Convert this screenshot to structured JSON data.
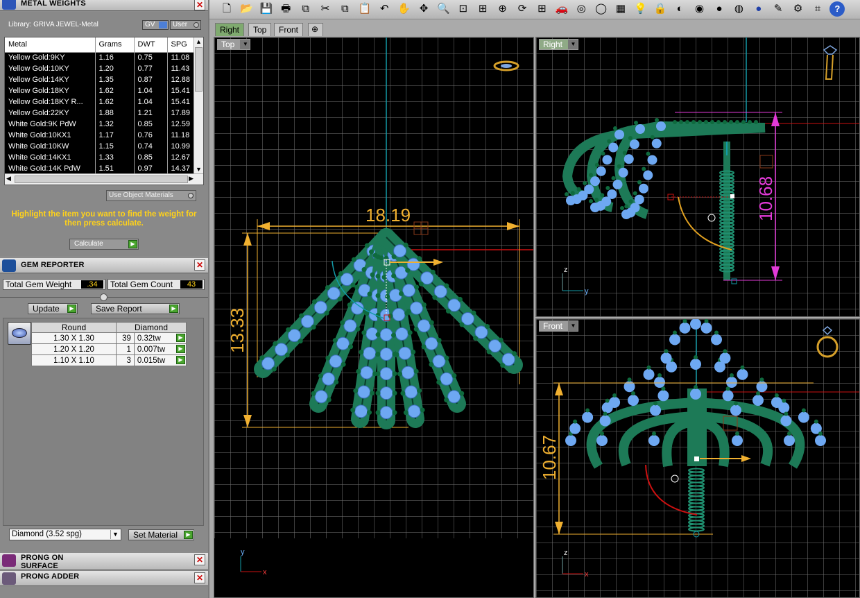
{
  "metal_weights": {
    "title": "METAL WEIGHTS",
    "library_label": "Library: GRIVA JEWEL-Metal",
    "toggle_gv": "GV",
    "toggle_user": "User",
    "columns": [
      "Metal",
      "Grams",
      "DWT",
      "SPG"
    ],
    "rows": [
      [
        "Yellow Gold:9KY",
        "1.16",
        "0.75",
        "11.08"
      ],
      [
        "Yellow Gold:10KY",
        "1.20",
        "0.77",
        "11.43"
      ],
      [
        "Yellow Gold:14KY",
        "1.35",
        "0.87",
        "12.88"
      ],
      [
        "Yellow Gold:18KY",
        "1.62",
        "1.04",
        "15.41"
      ],
      [
        "Yellow Gold:18KY R...",
        "1.62",
        "1.04",
        "15.41"
      ],
      [
        "Yellow Gold:22KY",
        "1.88",
        "1.21",
        "17.89"
      ],
      [
        "White Gold:9K PdW",
        "1.32",
        "0.85",
        "12.59"
      ],
      [
        "White Gold:10KX1",
        "1.17",
        "0.76",
        "11.18"
      ],
      [
        "White Gold:10KW",
        "1.15",
        "0.74",
        "10.99"
      ],
      [
        "White Gold:14KX1",
        "1.33",
        "0.85",
        "12.67"
      ],
      [
        "White Gold:14K PdW",
        "1.51",
        "0.97",
        "14.37"
      ]
    ],
    "use_object_materials": "Use Object Materials",
    "instruction": "Highlight the item you want to find the weight for then press calculate.",
    "calculate_label": "Calculate"
  },
  "gem_reporter": {
    "title": "GEM REPORTER",
    "total_weight_label": "Total Gem Weight",
    "total_weight_value": ".34",
    "total_count_label": "Total Gem Count",
    "total_count_value": "43",
    "update_label": "Update",
    "save_report_label": "Save Report",
    "columns": [
      "Round",
      "Diamond"
    ],
    "rows": [
      [
        "1.30 X 1.30",
        "39",
        "0.32tw"
      ],
      [
        "1.20 X 1.20",
        "1",
        "0.007tw"
      ],
      [
        "1.10 X 1.10",
        "3",
        "0.015tw"
      ]
    ],
    "material_select": "Diamond    (3.52 spg)",
    "set_material_label": "Set Material"
  },
  "prong_on_surface": {
    "title": "PRONG ON SURFACE"
  },
  "prong_adder": {
    "title": "PRONG ADDER"
  },
  "viewport_tabs": [
    "Right",
    "Top",
    "Front"
  ],
  "viewports": {
    "top": {
      "label": "Top",
      "width_dim": "18.19",
      "height_dim": "13.33"
    },
    "right": {
      "label": "Right",
      "height_dim": "10.68"
    },
    "front": {
      "label": "Front",
      "height_dim": "10.67"
    }
  },
  "axes": {
    "x": "x",
    "y": "y",
    "z": "z"
  },
  "toolbar_icons": [
    "new-icon",
    "open-icon",
    "save-icon",
    "print-icon",
    "copy-icon",
    "cut-icon",
    "duplicate-icon",
    "paste-icon",
    "undo-icon",
    "pan-icon",
    "move-icon",
    "zoom-icon",
    "zoom-window-icon",
    "zoom-extents-icon",
    "zoom-target-icon",
    "rotate-view-icon",
    "four-views-icon",
    "car-icon",
    "camera-icon",
    "circle-icon",
    "layers-icon",
    "light-icon",
    "lock-icon",
    "material-icon",
    "color-icon",
    "sphere-icon",
    "render-sphere-icon",
    "blue-sphere-icon",
    "pencil-icon",
    "gear-icon",
    "crop-icon",
    "help-icon"
  ],
  "colors": {
    "dim_orange": "#f0b030",
    "dim_magenta": "#e23ad8",
    "metal_green": "#1d7a57",
    "stone_blue": "#6ea8f2",
    "axis_red": "#cc1010",
    "axis_teal": "#139ba8"
  }
}
